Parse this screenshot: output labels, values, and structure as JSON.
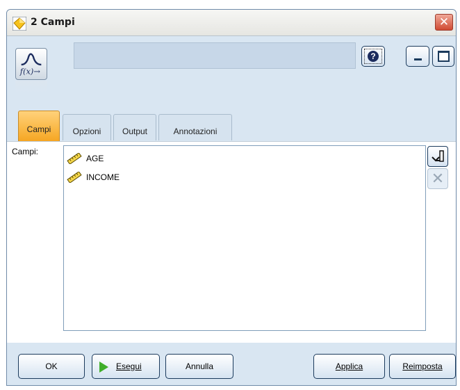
{
  "window": {
    "title": "2 Campi"
  },
  "toolbar": {
    "node_icon_label": "f(x)→",
    "help_glyph": "?"
  },
  "tabs": [
    {
      "label": "Campi",
      "active": true
    },
    {
      "label": "Opzioni",
      "active": false
    },
    {
      "label": "Output",
      "active": false
    },
    {
      "label": "Annotazioni",
      "active": false
    }
  ],
  "panel": {
    "fields_label": "Campi:",
    "fields": [
      {
        "name": "AGE",
        "icon": "ruler-icon"
      },
      {
        "name": "INCOME",
        "icon": "ruler-icon"
      }
    ]
  },
  "buttons": {
    "ok": "OK",
    "esegui": "Esegui",
    "annulla": "Annulla",
    "applica": "Applica",
    "reimposta": "Reimposta"
  },
  "colors": {
    "active_tab": "#f6a623",
    "window_bg": "#d9e6f2",
    "close": "#d04a32",
    "run_arrow": "#3fae2a"
  }
}
